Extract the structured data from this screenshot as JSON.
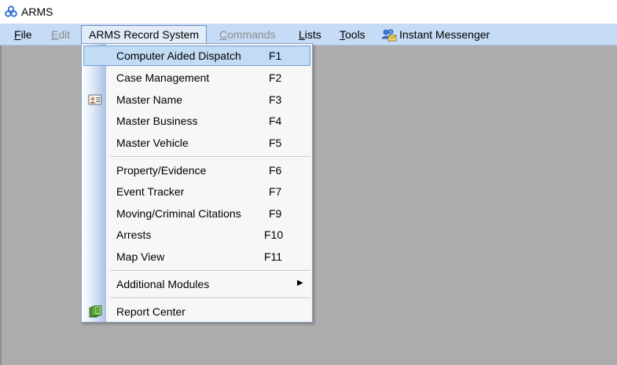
{
  "app": {
    "title": "ARMS"
  },
  "menubar": {
    "items": [
      {
        "label": "File",
        "mnemonic": "F",
        "rest": "ile",
        "disabled": false
      },
      {
        "label": "Edit",
        "mnemonic": "E",
        "rest": "dit",
        "disabled": true
      },
      {
        "label": "ARMS Record System",
        "open": true
      },
      {
        "label": "Commands",
        "mnemonic": "C",
        "rest": "ommands",
        "disabled": true
      },
      {
        "label": "Lists",
        "mnemonic": "L",
        "rest": "ists",
        "disabled": false
      },
      {
        "label": "Tools",
        "mnemonic": "T",
        "rest": "ools",
        "disabled": false
      },
      {
        "label": "Instant Messenger",
        "icon": "messenger-icon"
      }
    ]
  },
  "dropdown": {
    "items": [
      {
        "label": "Computer Aided Dispatch",
        "shortcut": "F1",
        "selected": true
      },
      {
        "label": "Case Management",
        "shortcut": "F2"
      },
      {
        "label": "Master Name",
        "shortcut": "F3",
        "icon": "id-card-icon"
      },
      {
        "label": "Master Business",
        "shortcut": "F4"
      },
      {
        "label": "Master Vehicle",
        "shortcut": "F5"
      },
      {
        "label": "Property/Evidence",
        "shortcut": "F6"
      },
      {
        "label": "Event Tracker",
        "shortcut": "F7"
      },
      {
        "label": "Moving/Criminal Citations",
        "shortcut": "F9"
      },
      {
        "label": "Arrests",
        "shortcut": "F10"
      },
      {
        "label": "Map View",
        "shortcut": "F11"
      },
      {
        "label": "Additional Modules",
        "submenu": true
      },
      {
        "label": "Report Center",
        "icon": "report-center-icon"
      }
    ]
  },
  "colors": {
    "menubar": "#c6dbf5",
    "workspace": "#acacac",
    "selection": "#c3dcf6",
    "disabled_text": "#8c8c8c"
  }
}
